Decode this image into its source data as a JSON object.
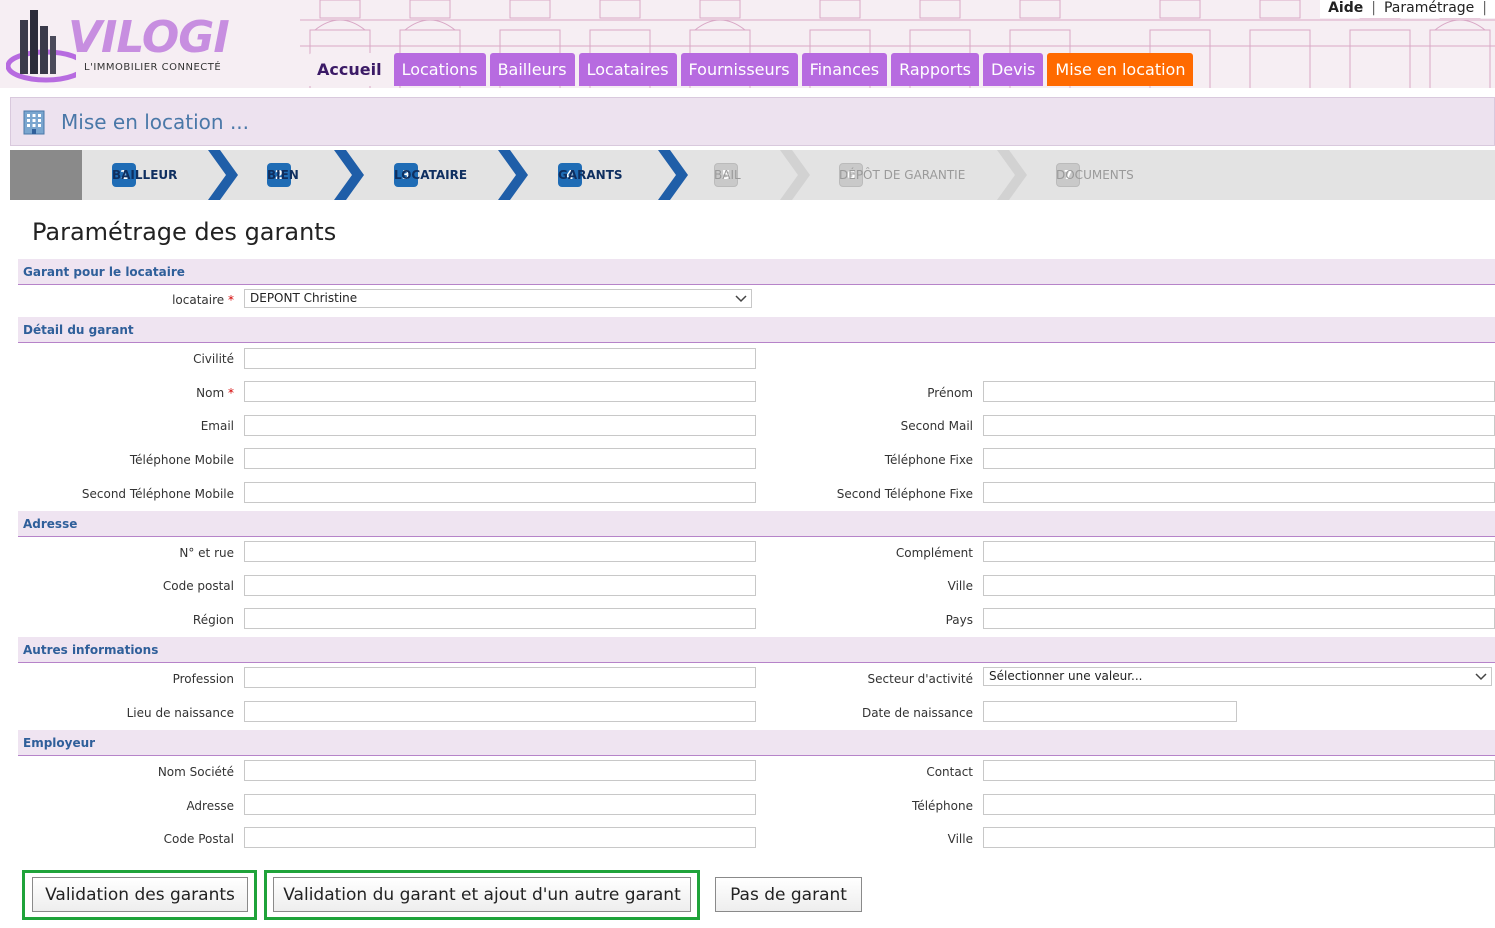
{
  "header": {
    "logo": {
      "name": "VILOGI",
      "tagline": "L'IMMOBILIER CONNECTÉ"
    },
    "top_links": {
      "aide": "Aide",
      "separator": "|",
      "parametrage": "Paramétrage"
    },
    "nav": [
      "Accueil",
      "Locations",
      "Bailleurs",
      "Locataires",
      "Fournisseurs",
      "Finances",
      "Rapports",
      "Devis",
      "Mise en location"
    ],
    "active_tab": "Mise en location",
    "colors": {
      "nav_tab": "#b76be0",
      "active_tab": "#ff6a00",
      "home_tab_text": "#3b1a66"
    }
  },
  "page": {
    "title": "Mise en location ...",
    "icon": "building-icon"
  },
  "wizard": {
    "steps": [
      {
        "num": "1",
        "label": "BAILLEUR",
        "state": "done"
      },
      {
        "num": "2",
        "label": "BIEN",
        "state": "done"
      },
      {
        "num": "3",
        "label": "LOCATAIRE",
        "state": "done"
      },
      {
        "num": "4",
        "label": "GARANTS",
        "state": "current"
      },
      {
        "num": "5",
        "label": "BAIL",
        "state": "todo"
      },
      {
        "num": "6",
        "label": "DÉPÔT DE GARANTIE",
        "state": "todo"
      },
      {
        "num": "7",
        "label": "DOCUMENTS",
        "state": "todo"
      }
    ]
  },
  "form": {
    "title": "Paramétrage des garants",
    "sections": {
      "garant_locataire": "Garant pour le locataire",
      "detail": "Détail du garant",
      "adresse": "Adresse",
      "autres": "Autres informations",
      "employeur": "Employeur"
    },
    "required_mark": "*",
    "fields": {
      "locataire": {
        "label": "locataire",
        "value": "DEPONT Christine"
      },
      "civilite": {
        "label": "Civilité",
        "value": ""
      },
      "nom": {
        "label": "Nom",
        "value": ""
      },
      "prenom": {
        "label": "Prénom",
        "value": ""
      },
      "email": {
        "label": "Email",
        "value": ""
      },
      "second_mail": {
        "label": "Second Mail",
        "value": ""
      },
      "tel_mobile": {
        "label": "Téléphone Mobile",
        "value": ""
      },
      "tel_fixe": {
        "label": "Téléphone Fixe",
        "value": ""
      },
      "second_tel_mobile": {
        "label": "Second Téléphone Mobile",
        "value": ""
      },
      "second_tel_fixe": {
        "label": "Second Téléphone Fixe",
        "value": ""
      },
      "no_rue": {
        "label": "N° et rue",
        "value": ""
      },
      "complement": {
        "label": "Complément",
        "value": ""
      },
      "code_postal": {
        "label": "Code postal",
        "value": ""
      },
      "ville": {
        "label": "Ville",
        "value": ""
      },
      "region": {
        "label": "Région",
        "value": ""
      },
      "pays": {
        "label": "Pays",
        "value": ""
      },
      "profession": {
        "label": "Profession",
        "value": ""
      },
      "secteur": {
        "label": "Secteur d'activité",
        "value": "Sélectionner une valeur..."
      },
      "lieu_naissance": {
        "label": "Lieu de naissance",
        "value": ""
      },
      "date_naissance": {
        "label": "Date de naissance",
        "value": ""
      },
      "nom_societe": {
        "label": "Nom Société",
        "value": ""
      },
      "contact": {
        "label": "Contact",
        "value": ""
      },
      "emp_adresse": {
        "label": "Adresse",
        "value": ""
      },
      "emp_telephone": {
        "label": "Téléphone",
        "value": ""
      },
      "emp_code_postal": {
        "label": "Code Postal",
        "value": ""
      },
      "emp_ville": {
        "label": "Ville",
        "value": ""
      }
    }
  },
  "buttons": {
    "validation": "Validation des garants",
    "validation_ajout": "Validation du garant et ajout d'un autre garant",
    "pas_de_garant": "Pas de garant",
    "highlight_color": "#1fa33a"
  }
}
